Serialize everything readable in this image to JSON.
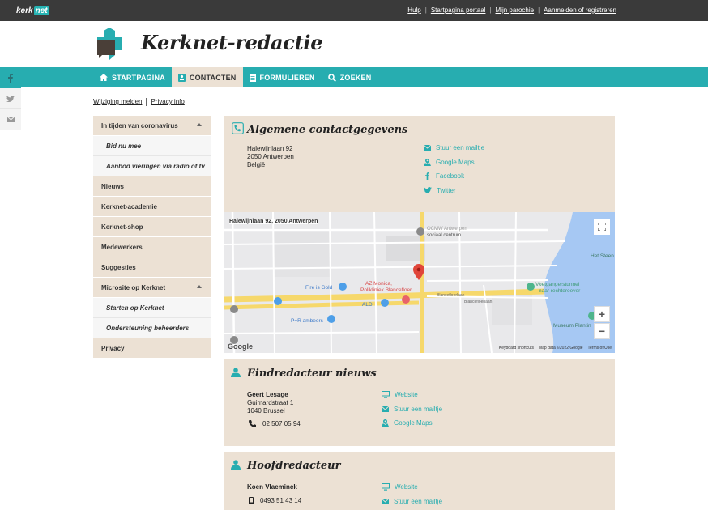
{
  "topbar": {
    "logo_kerk": "kerk",
    "logo_net": "net",
    "links": [
      "Hulp",
      "Startpagina portaal",
      "Mijn parochie",
      "Aanmelden of registreren"
    ]
  },
  "header": {
    "title": "Kerknet-redactie"
  },
  "nav": {
    "items": [
      {
        "label": "STARTPAGINA",
        "icon": "home-icon"
      },
      {
        "label": "CONTACTEN",
        "icon": "contact-card-icon"
      },
      {
        "label": "FORMULIEREN",
        "icon": "document-icon"
      },
      {
        "label": "ZOEKEN",
        "icon": "search-icon"
      }
    ],
    "active": "CONTACTEN"
  },
  "social": [
    "facebook-icon",
    "twitter-icon",
    "mail-icon"
  ],
  "sublinks": [
    "Wijziging melden",
    "Privacy info"
  ],
  "sidebar": {
    "items": [
      {
        "label": "In tijden van coronavirus",
        "expanded": true
      },
      {
        "label": "Bid nu mee",
        "sub": true
      },
      {
        "label": "Aanbod vieringen via radio of tv",
        "sub": true
      },
      {
        "label": "Nieuws"
      },
      {
        "label": "Kerknet-academie"
      },
      {
        "label": "Kerknet-shop"
      },
      {
        "label": "Medewerkers"
      },
      {
        "label": "Suggesties"
      },
      {
        "label": "Microsite op Kerknet",
        "expanded": true
      },
      {
        "label": "Starten op Kerknet",
        "sub": true
      },
      {
        "label": "Ondersteuning beheerders",
        "sub": true
      },
      {
        "label": "Privacy"
      }
    ]
  },
  "contact": {
    "title": "Algemene contactgegevens",
    "address": [
      "Halewijnlaan 92",
      "2050 Antwerpen",
      "België"
    ],
    "links": [
      {
        "label": "Stuur een mailtje",
        "icon": "mail-icon"
      },
      {
        "label": "Google Maps",
        "icon": "map-pin-icon"
      },
      {
        "label": "Facebook",
        "icon": "facebook-icon"
      },
      {
        "label": "Twitter",
        "icon": "twitter-icon"
      }
    ]
  },
  "map": {
    "address_label": "Halewijnlaan 92, 2050 Antwerpen",
    "labels": [
      "OCMW Antwerpen",
      "sociaal centrum...",
      "Fire is Gold",
      "AZ Monica,",
      "Polikliniek Blancefloer",
      "ALDI",
      "P+R ambeers",
      "Voetgangerstunnel",
      "naar rechteroever",
      "Museum Plantin",
      "Het Steen",
      "Blancefloerlaan",
      "Blancefloerlaan"
    ],
    "footer": [
      "Keyboard shortcuts",
      "Map data ©2022 Google",
      "Terms of Use"
    ],
    "google": "Google",
    "zoom_in": "+",
    "zoom_out": "−"
  },
  "editor_news": {
    "title": "Eindredacteur nieuws",
    "name": "Geert Lesage",
    "address": [
      "Guimardstraat 1",
      "1040 Brussel"
    ],
    "phone": "02 507 05 94",
    "links": [
      {
        "label": "Website",
        "icon": "monitor-icon"
      },
      {
        "label": "Stuur een mailtje",
        "icon": "mail-icon"
      },
      {
        "label": "Google Maps",
        "icon": "map-pin-icon"
      }
    ]
  },
  "chief_editor": {
    "title": "Hoofdredacteur",
    "name": "Koen Vlaeminck",
    "phone": "0493 51 43 14",
    "links": [
      {
        "label": "Website",
        "icon": "monitor-icon"
      },
      {
        "label": "Stuur een mailtje",
        "icon": "mail-icon"
      }
    ]
  },
  "colors": {
    "teal": "#27adb0",
    "beige": "#ece1d4",
    "dark": "#3a3a3a"
  }
}
